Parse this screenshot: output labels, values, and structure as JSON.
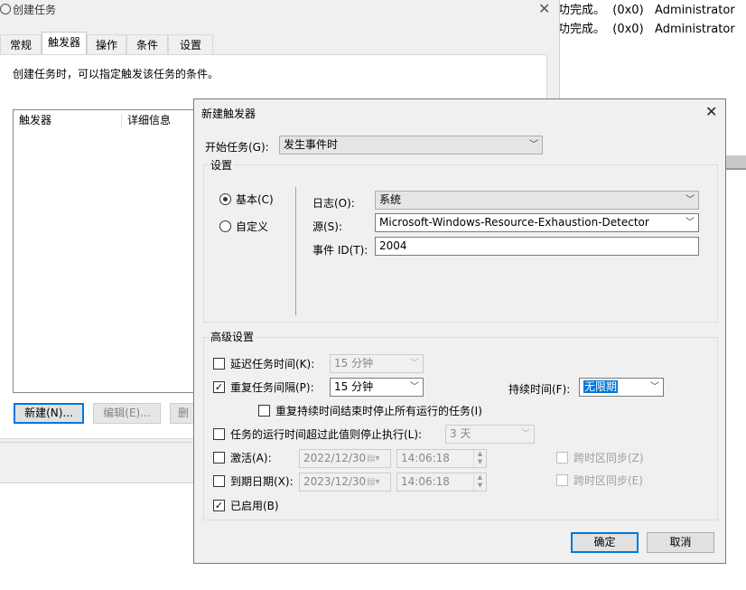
{
  "background_log": [
    {
      "text": "功完成。  (0x0)   Administrator"
    },
    {
      "text": "功完成。  (0x0)   Administrator"
    }
  ],
  "parent": {
    "title": "创建任务",
    "tabs": [
      "常规",
      "触发器",
      "操作",
      "条件",
      "设置"
    ],
    "active_tab": "触发器",
    "description": "创建任务时，可以指定触发该任务的条件。",
    "list_headers": [
      "触发器",
      "详细信息"
    ],
    "buttons": {
      "new": "新建(N)...",
      "edit": "编辑(E)...",
      "delete": "删"
    }
  },
  "dialog": {
    "title": "新建触发器",
    "begin_label": "开始任务(G):",
    "begin_value": "发生事件时",
    "settings_legend": "设置",
    "radio_basic": "基本(C)",
    "radio_custom": "自定义",
    "log_label": "日志(O):",
    "log_value": "系统",
    "source_label": "源(S):",
    "source_value": "Microsoft-Windows-Resource-Exhaustion-Detector",
    "eventid_label": "事件 ID(T):",
    "eventid_value": "2004",
    "advanced_legend": "高级设置",
    "delay_label": "延迟任务时间(K):",
    "delay_value": "15 分钟",
    "repeat_label": "重复任务间隔(P):",
    "repeat_value": "15 分钟",
    "duration_label": "持续时间(F):",
    "duration_value": "无限期",
    "stop_all_label": "重复持续时间结束时停止所有运行的任务(I)",
    "stop_longer_label": "任务的运行时间超过此值则停止执行(L):",
    "stop_longer_value": "3 天",
    "activate_label": "激活(A):",
    "activate_date": "2022/12/30",
    "activate_time": "14:06:18",
    "activate_sync": "跨时区同步(Z)",
    "expire_label": "到期日期(X):",
    "expire_date": "2023/12/30",
    "expire_time": "14:06:18",
    "expire_sync": "跨时区同步(E)",
    "enabled_label": "已启用(B)",
    "ok": "确定",
    "cancel": "取消"
  },
  "icons": {
    "close": "close-icon",
    "dropdown": "chevron-down-icon",
    "calendar": "calendar-icon",
    "spinner": "spinner-icon"
  }
}
